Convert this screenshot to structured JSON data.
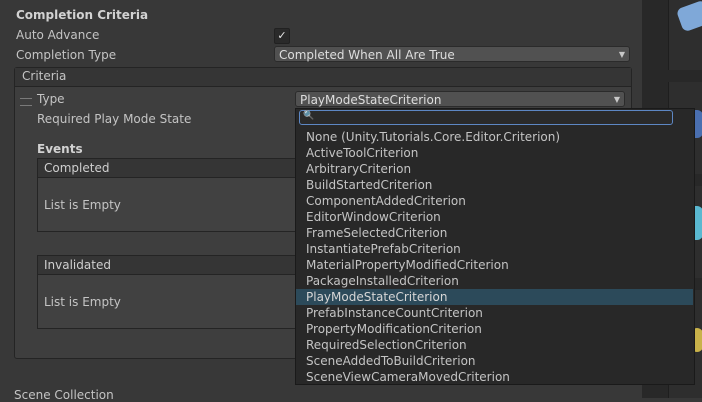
{
  "section_title": "Completion Criteria",
  "auto_advance": {
    "label": "Auto Advance",
    "checked": true,
    "check_glyph": "✓"
  },
  "completion_type": {
    "label": "Completion Type",
    "value": "Completed When All Are True"
  },
  "criteria": {
    "header": "Criteria",
    "type_label": "Type",
    "type_value": "PlayModeStateCriterion",
    "required_label": "Required Play Mode State",
    "events_title": "Events",
    "completed_header": "Completed",
    "completed_empty": "List is Empty",
    "invalidated_header": "Invalidated",
    "invalidated_empty": "List is Empty"
  },
  "dropdown_popup": {
    "search_value": "",
    "options": [
      "None (Unity.Tutorials.Core.Editor.Criterion)",
      "ActiveToolCriterion",
      "ArbitraryCriterion",
      "BuildStartedCriterion",
      "ComponentAddedCriterion",
      "EditorWindowCriterion",
      "FrameSelectedCriterion",
      "InstantiatePrefabCriterion",
      "MaterialPropertyModifiedCriterion",
      "PackageInstalledCriterion",
      "PlayModeStateCriterion",
      "PrefabInstanceCountCriterion",
      "PropertyModificationCriterion",
      "RequiredSelectionCriterion",
      "SceneAddedToBuildCriterion",
      "SceneViewCameraMovedCriterion"
    ],
    "selected": "PlayModeStateCriterion"
  },
  "footer_partial": "Scene Collection"
}
